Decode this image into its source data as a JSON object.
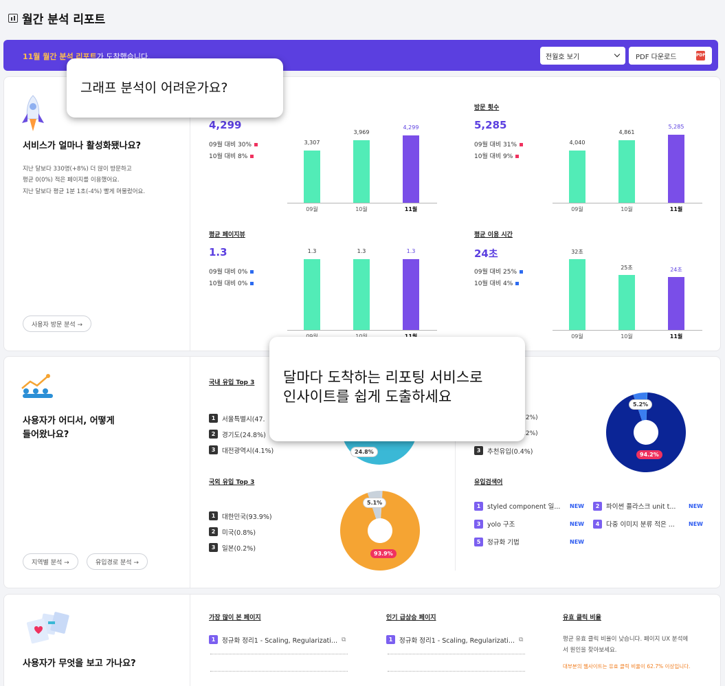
{
  "page_title": "월간 분석 리포트",
  "banner": {
    "highlight": "11월 월간 분석 리포트",
    "rest": "가 도착했습니다."
  },
  "select": {
    "value": "전월호 보기"
  },
  "pdf_button": {
    "label": "PDF 다운로드",
    "icon_text": "PDF"
  },
  "section1": {
    "heading": "서비스가 얼마나 활성화됐나요?",
    "desc": [
      "지난 달보다 330명(+8%) 더 많이 방문하고",
      "평균 0(0%) 적은 페이지를 이용했어요.",
      "지난 달보다 평균 1분 1초(-4%) 빨게 머물렀어요."
    ],
    "button": "사용자 방문 분석 →"
  },
  "metrics": [
    {
      "label": "",
      "value": "4,299",
      "cmp1": "09월 대비 30%",
      "cmp2": "10월 대비 8%",
      "dot": "red",
      "months": [
        "09월",
        "10월",
        "11월"
      ],
      "values": [
        3307,
        3969,
        4299
      ],
      "value_labels": [
        "3,307",
        "3,969",
        "4,299"
      ],
      "ymax": 4500
    },
    {
      "label": "방문 횟수",
      "value": "5,285",
      "cmp1": "09월 대비 31%",
      "cmp2": "10월 대비 9%",
      "dot": "red",
      "months": [
        "09월",
        "10월",
        "11월"
      ],
      "values": [
        4040,
        4861,
        5285
      ],
      "value_labels": [
        "4,040",
        "4,861",
        "5,285"
      ],
      "ymax": 5500
    },
    {
      "label": "평균 페이지뷰",
      "value": "1.3",
      "cmp1": "09월 대비 0%",
      "cmp2": "10월 대비 0%",
      "dot": "blue",
      "months": [
        "09월",
        "10월",
        "11월"
      ],
      "values": [
        1.3,
        1.3,
        1.3
      ],
      "value_labels": [
        "1.3",
        "1.3",
        "1.3"
      ],
      "ymax": 1.3
    },
    {
      "label": "평균 이용 시간",
      "value": "24초",
      "cmp1": "09월 대비 25%",
      "cmp2": "10월 대비 4%",
      "dot": "blue",
      "months": [
        "09월",
        "10월",
        "11월"
      ],
      "values": [
        32,
        25,
        24
      ],
      "value_labels": [
        "32초",
        "25초",
        "24초"
      ],
      "ymax": 32
    }
  ],
  "section2": {
    "heading": [
      "사용자가 어디서, 어떻게",
      "들어왔나요?"
    ],
    "buttons": [
      "지역별 분석 →",
      "유입경로 분석 →"
    ]
  },
  "domestic": {
    "label": "국내 유입 Top 3",
    "items": [
      "서울특별시(47.",
      "경기도(24.8%)",
      "대전광역시(4.1%)"
    ],
    "pie_tag": "24.8%"
  },
  "foreign": {
    "label": "국외 유입 Top 3",
    "items": [
      "대한민국(93.9%)",
      "미국(0.8%)",
      "일본(0.2%)"
    ],
    "tags": [
      "5.1%",
      "93.9%"
    ],
    "values": [
      93.9,
      5.1,
      1.0
    ]
  },
  "channel": {
    "items": [
      "추천유입(0.4%)"
    ],
    "partials": [
      ".2%)",
      ".2%)"
    ],
    "tags": [
      "5.2%",
      "94.2%"
    ],
    "values": [
      94.2,
      5.2,
      0.6
    ]
  },
  "keywords": {
    "label": "유입검색어",
    "items": [
      {
        "n": "1",
        "t": "styled component 일...",
        "new": "NEW"
      },
      {
        "n": "2",
        "t": "파이썬 플라스크 unit t...",
        "new": "NEW"
      },
      {
        "n": "3",
        "t": "yolo 구조",
        "new": "NEW"
      },
      {
        "n": "4",
        "t": "다중 이미지 분류 적은 ...",
        "new": "NEW"
      },
      {
        "n": "5",
        "t": "정규화 기법",
        "new": "NEW"
      }
    ]
  },
  "section3": {
    "heading": "사용자가 무엇을 보고 가나요?"
  },
  "top_pages": {
    "label": "가장 많이 본 페이지",
    "item": "정규화 정리1 - Scaling, Regularizati..."
  },
  "rising_pages": {
    "label": "인기 급상승 페이지",
    "item": "정규화 정리1 - Scaling, Regularizati..."
  },
  "valid_click": {
    "label": "유효 클릭 비율",
    "desc": [
      "평균 유효 클릭 비율이 낮습니다. 페이지 UX 분석에",
      "서 원인을 찾아보세요."
    ],
    "note": "대부분의 웹사이트는 유효 클릭 비율이 62.7% 이상입니다."
  },
  "tooltip1": "그래프 분석이 어려운가요?",
  "tooltip2": [
    "달마다 도착하는 리포팅 서비스로",
    "인사이트를 쉽게 도출하세요"
  ],
  "colors": {
    "primary": "#5b3fe0",
    "green": "#52ecb7",
    "purple": "#7a4ee8",
    "navy": "#0b2596",
    "orange": "#f5a433",
    "cyan": "#3ab8d6",
    "red": "#f0325f"
  }
}
